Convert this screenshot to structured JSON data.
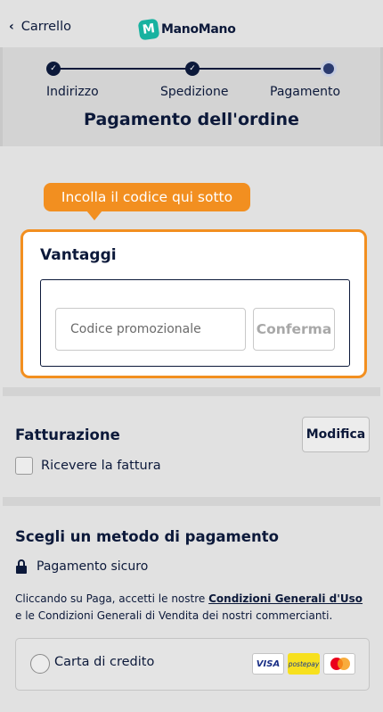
{
  "header": {
    "back_label": "Carrello",
    "logo_letter": "M",
    "logo_text": "ManoMano"
  },
  "stepper": {
    "steps": [
      {
        "label": "Indirizzo",
        "state": "done"
      },
      {
        "label": "Spedizione",
        "state": "done"
      },
      {
        "label": "Pagamento",
        "state": "current"
      }
    ],
    "check_glyph": "✓",
    "title": "Pagamento dell'ordine"
  },
  "tooltip": {
    "text": "Incolla il codice qui sotto"
  },
  "promo": {
    "title": "Vantaggi",
    "input_placeholder": "Codice promozionale",
    "confirm_label": "Conferma"
  },
  "billing": {
    "title": "Fatturazione",
    "modify_label": "Modifica",
    "invoice_checkbox_label": "Ricevere la fattura",
    "invoice_checked": false
  },
  "payment": {
    "title": "Scegli un metodo di pagamento",
    "secure_label": "Pagamento sicuro",
    "terms_before": "Cliccando su Paga, accetti le nostre ",
    "terms_link": "Condizioni Generali d'Uso",
    "terms_after": " e le Condizioni Generali di Vendita dei nostri commercianti.",
    "options": [
      {
        "label": "Carta di credito",
        "selected": false,
        "brands": [
          {
            "name": "VISA",
            "icon": "visa-logo"
          },
          {
            "name": "postepay",
            "icon": "postepay-logo"
          },
          {
            "name": "mastercard",
            "icon": "mastercard-logo"
          }
        ]
      }
    ]
  },
  "colors": {
    "accent_orange": "#f28f20",
    "navy": "#0c193a",
    "logo_teal": "#18b2a0"
  }
}
